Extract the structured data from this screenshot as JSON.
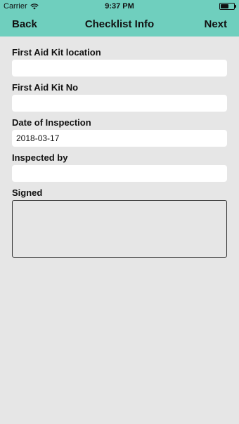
{
  "status_bar": {
    "carrier": "Carrier",
    "time": "9:37 PM",
    "battery_level": 0.6
  },
  "nav": {
    "back_label": "Back",
    "title": "Checklist Info",
    "next_label": "Next"
  },
  "form": {
    "location_label": "First Aid Kit location",
    "location_value": "",
    "kit_no_label": "First Aid Kit No",
    "kit_no_value": "",
    "date_label": "Date of Inspection",
    "date_value": "2018-03-17",
    "inspected_by_label": "Inspected by",
    "inspected_by_value": "",
    "signed_label": "Signed"
  },
  "colors": {
    "header": "#6fcfbe",
    "background": "#e6e6e6"
  }
}
